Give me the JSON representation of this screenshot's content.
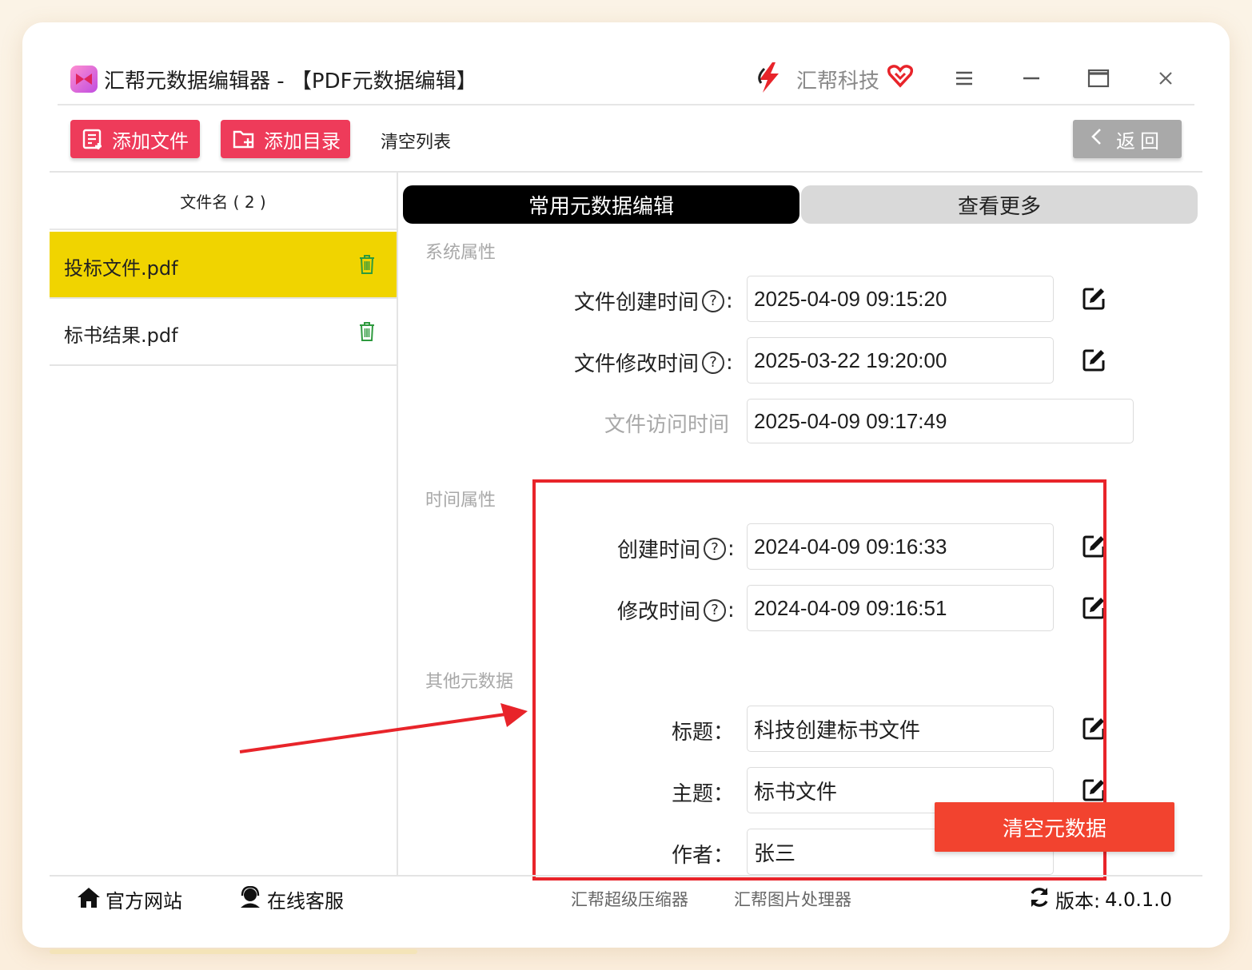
{
  "app": {
    "title": "汇帮元数据编辑器 - 【PDF元数据编辑】",
    "brand_name": "汇帮科技"
  },
  "toolbar": {
    "add_file_label": "添加文件",
    "add_dir_label": "添加目录",
    "clear_list_label": "清空列表",
    "back_label": "返回"
  },
  "file_list": {
    "header": "文件名 ( 2 )",
    "items": [
      {
        "name": "投标文件.pdf",
        "selected": true
      },
      {
        "name": "标书结果.pdf",
        "selected": false
      }
    ]
  },
  "tabs": [
    {
      "label": "常用元数据编辑",
      "active": true
    },
    {
      "label": "查看更多",
      "active": false
    }
  ],
  "sections": {
    "system": "系统属性",
    "time": "时间属性",
    "other": "其他元数据"
  },
  "fields": {
    "file_created": {
      "label": "文件创建时间",
      "value": "2025-04-09 09:15:20"
    },
    "file_modified": {
      "label": "文件修改时间",
      "value": "2025-03-22 19:20:00"
    },
    "file_accessed": {
      "label": "文件访问时间",
      "value": "2025-04-09 09:17:49"
    },
    "created": {
      "label": "创建时间",
      "value": "2024-04-09 09:16:33"
    },
    "modified": {
      "label": "修改时间",
      "value": "2024-04-09 09:16:51"
    },
    "title": {
      "label": "标题：",
      "value": "科技创建标书文件"
    },
    "subject": {
      "label": "主题：",
      "value": "标书文件"
    },
    "author": {
      "label": "作者：",
      "value": "张三"
    }
  },
  "help_glyph": "?",
  "colon": ":",
  "clear_meta_label": "清空元数据",
  "footer": {
    "website": "官方网站",
    "support": "在线客服",
    "compressor": "汇帮超级压缩器",
    "image_tool": "汇帮图片处理器",
    "version_label": "版本:",
    "version": "4.0.1.0"
  },
  "colors": {
    "accent_pink": "#ee3b5a",
    "selected_row": "#f0d400",
    "clear_button": "#f2432f",
    "highlight_box": "#e8242a"
  }
}
